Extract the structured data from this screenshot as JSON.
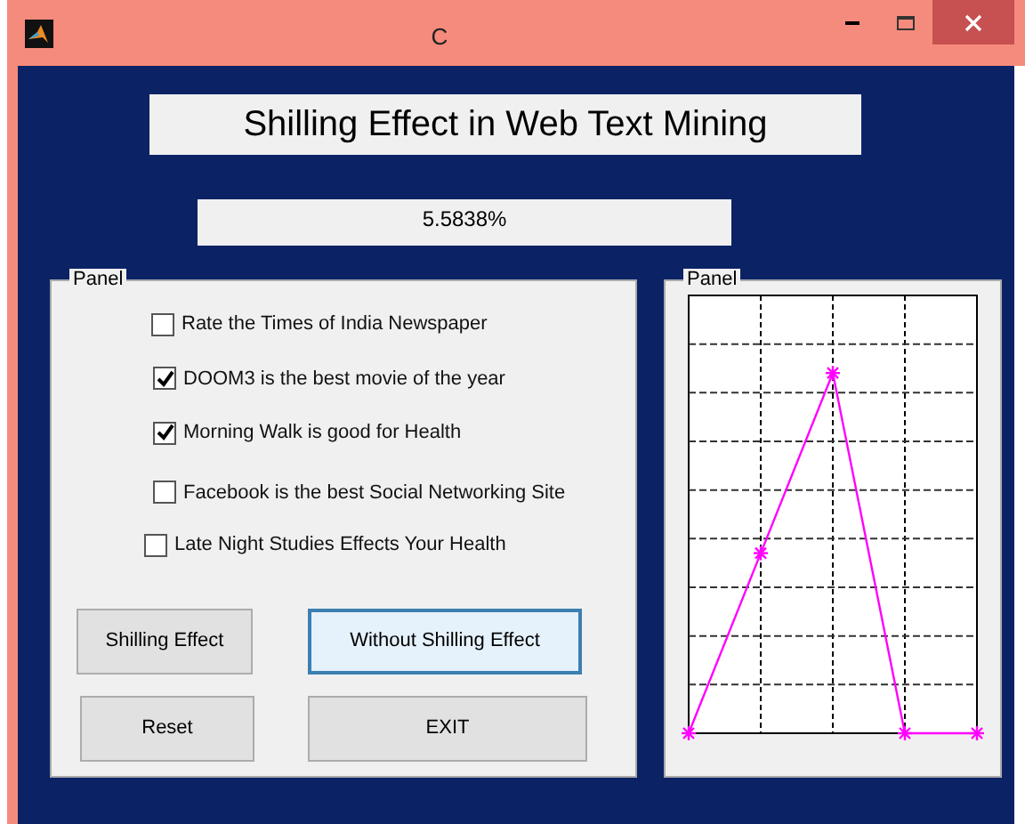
{
  "window": {
    "title": "C"
  },
  "heading": "Shilling Effect in Web Text Mining",
  "result": "5.5838%",
  "options_panel": {
    "title": "Panel",
    "checkboxes": [
      {
        "label": "Rate the Times of India Newspaper",
        "checked": false
      },
      {
        "label": "DOOM3 is the best movie of the year",
        "checked": true
      },
      {
        "label": "Morning Walk is good for Health",
        "checked": true
      },
      {
        "label": "Facebook is the best Social Networking Site",
        "checked": false
      },
      {
        "label": "Late Night Studies Effects Your Health",
        "checked": false
      }
    ],
    "buttons": [
      {
        "label": "Shilling Effect",
        "focused": false
      },
      {
        "label": "Without Shilling Effect",
        "focused": true
      },
      {
        "label": "Reset",
        "focused": false
      },
      {
        "label": "EXIT",
        "focused": false
      }
    ]
  },
  "chart_panel": {
    "title": "Panel"
  }
}
